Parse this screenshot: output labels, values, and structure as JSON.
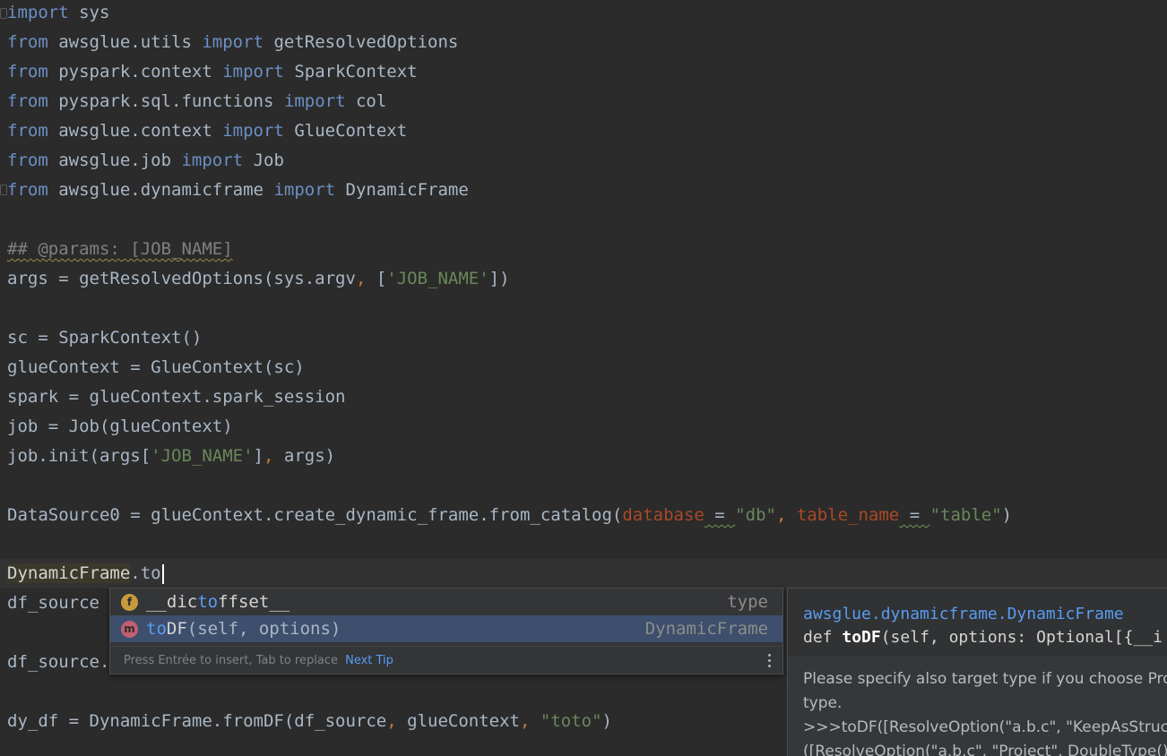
{
  "editor": {
    "lines": {
      "l1_kw": "import",
      "l1_rest": " sys",
      "l2_from": "from",
      "l2_mod": " awsglue.utils ",
      "l2_imp": "import",
      "l2_name": " getResolvedOptions",
      "l3_from": "from",
      "l3_mod": " pyspark.context ",
      "l3_imp": "import",
      "l3_name": " SparkContext",
      "l4_from": "from",
      "l4_mod": " pyspark.sql.functions ",
      "l4_imp": "import",
      "l4_name": " col",
      "l5_from": "from",
      "l5_mod": " awsglue.context ",
      "l5_imp": "import",
      "l5_name": " GlueContext",
      "l6_from": "from",
      "l6_mod": " awsglue.job ",
      "l6_imp": "import",
      "l6_name": " Job",
      "l7_from": "from",
      "l7_mod": " awsglue.dynamicframe ",
      "l7_imp": "import",
      "l7_name": " DynamicFrame",
      "l8_comment": "## @params: [JOB_NAME]",
      "l9_a": "args = getResolvedOptions(sys.argv",
      "l9_comma": ",",
      "l9_b": " [",
      "l9_str": "'JOB_NAME'",
      "l9_c": "])",
      "l10": "sc = SparkContext()",
      "l11": "glueContext = GlueContext(sc)",
      "l12": "spark = glueContext.spark_session",
      "l13": "job = Job(glueContext)",
      "l14_a": "job.init(args[",
      "l14_str": "'JOB_NAME'",
      "l14_b": "]",
      "l14_comma": ",",
      "l14_c": " args)",
      "l15_a": "DataSource0 = glueContext.create_dynamic_frame.from_catalog(",
      "l15_p1": "database",
      "l15_eq1": " = ",
      "l15_s1": "\"db\"",
      "l15_comma": ",",
      "l15_sp": " ",
      "l15_p2": "table_name",
      "l15_eq2": " = ",
      "l15_s2": "\"table\"",
      "l15_end": ")",
      "l16_ident": "DynamicFrame",
      "l16_rest": ".to",
      "l17": "df_source",
      "l18": "df_source.",
      "l19_a": "dy_df = DynamicFrame.fromDF(df_source",
      "l19_comma1": ",",
      "l19_b": " glueContext",
      "l19_comma2": ",",
      "l19_sp": " ",
      "l19_str": "\"toto\"",
      "l19_c": ")"
    }
  },
  "completion": {
    "items": [
      {
        "badge": "f",
        "badge_color": "#c99a3c",
        "pre": "__dic",
        "match": "to",
        "post": "ffset__",
        "sig": "",
        "tail": "type"
      },
      {
        "badge": "m",
        "badge_color": "#c25f72",
        "pre": "",
        "match": "to",
        "post": "DF",
        "sig": "(self, options)",
        "tail": "DynamicFrame"
      }
    ],
    "footer_hint": "Press Entrée to insert, Tab to replace",
    "footer_tip": "Next Tip"
  },
  "doc": {
    "qualified_name": "awsglue.dynamicframe.DynamicFrame",
    "sig_def": "def ",
    "sig_name": "toDF",
    "sig_rest": "(self, options: Optional[{__i",
    "body_line1": "Please specify also target type if you choose Proj",
    "body_line2": "type.",
    "body_line3": ">>>toDF([ResolveOption(\"a.b.c\", \"KeepAsStruct\")",
    "body_line4": "([ResolveOption(\"a.b.c\", \"Project\", DoubleType())]"
  }
}
